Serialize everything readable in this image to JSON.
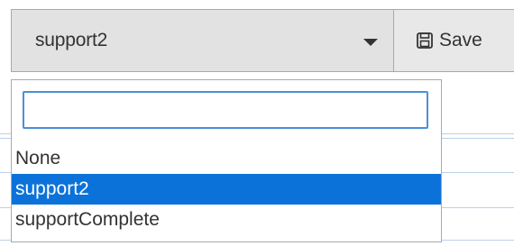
{
  "select": {
    "value": "support2",
    "options": [
      "None",
      "support2",
      "supportComplete"
    ],
    "selected_index": 1,
    "search_placeholder": "",
    "search_value": ""
  },
  "toolbar": {
    "save_label": "Save"
  },
  "icons": {
    "caret": "chevron-down-icon",
    "save": "floppy-disk-icon"
  },
  "colors": {
    "selected_option_bg": "#0b72d9",
    "search_border": "#4a90d9"
  }
}
